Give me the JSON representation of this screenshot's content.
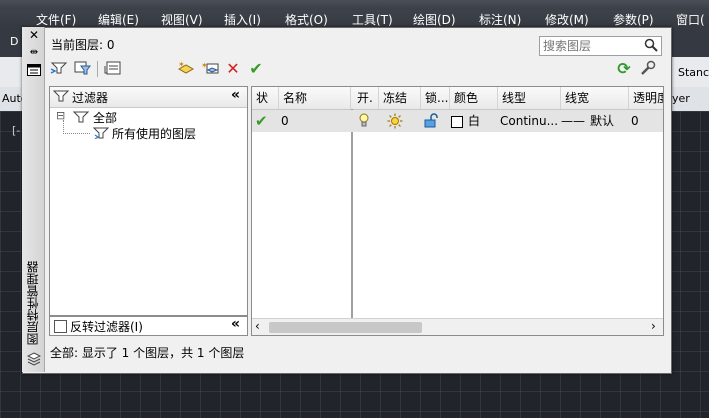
{
  "menubar": {
    "items": [
      "文件(F)",
      "编辑(E)",
      "视图(V)",
      "插入(I)",
      "格式(O)",
      "工具(T)",
      "绘图(D)",
      "标注(N)",
      "修改(M)",
      "参数(P)",
      "窗口("
    ]
  },
  "background": {
    "tab_label": "D",
    "right_label_1": "Stanc",
    "left_label_2": "Auto",
    "right_label_2": "yer",
    "canvas_label": "[-"
  },
  "palette": {
    "side_title": "图层特性管理器",
    "current_layer_label": "当前图层: 0",
    "search": {
      "placeholder": "搜索图层"
    },
    "filter_panel": {
      "header": "过滤器",
      "tree": [
        {
          "label": "全部",
          "expander": "⊟"
        },
        {
          "label": "所有使用的图层"
        }
      ],
      "invert_label": "反转过滤器(I)"
    },
    "table": {
      "columns": [
        "状",
        "名称",
        "开.",
        "冻结",
        "锁...",
        "颜色",
        "线型",
        "线宽",
        "透明度"
      ],
      "rows": [
        {
          "status": "✔",
          "name": "0",
          "on": "💡",
          "freeze": "☀",
          "lock": "🔓",
          "color": "白",
          "linetype": "Continu...",
          "lineweight_line": "——",
          "lineweight": "默认",
          "transparency": "0"
        }
      ]
    },
    "status_text": "全部: 显示了 1 个图层，共 1 个图层",
    "colors": {
      "selected_row": "#e4e4e4",
      "check_green": "#3a9a2a",
      "delete_red": "#d42020"
    }
  }
}
